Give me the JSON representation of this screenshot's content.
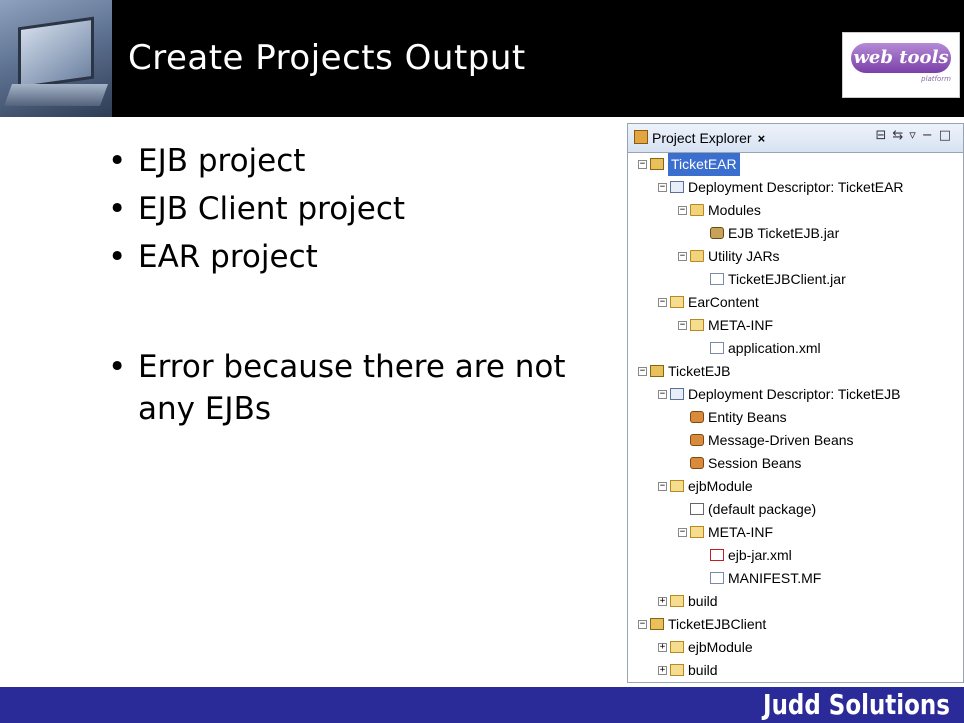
{
  "slide": {
    "title": "Create Projects Output",
    "logo_text": "web tools",
    "logo_subtext": "platform",
    "bullets": [
      {
        "text": "EJB project"
      },
      {
        "text": "EJB Client project"
      },
      {
        "text": "EAR project"
      },
      {
        "text": "Error because there are not any EJBs"
      }
    ],
    "footer_brand": "Judd Solutions"
  },
  "explorer": {
    "tab_label": "Project Explorer",
    "tree": [
      {
        "label": "TicketEAR",
        "icon": "ear-project-icon",
        "selected": true,
        "toggle": "−"
      },
      {
        "label": "Deployment Descriptor: TicketEAR",
        "icon": "deployment-descriptor-icon",
        "toggle": "−"
      },
      {
        "label": "Modules",
        "icon": "folder-icon",
        "toggle": "−"
      },
      {
        "label": "EJB TicketEJB.jar",
        "icon": "ejb-jar-icon"
      },
      {
        "label": "Utility JARs",
        "icon": "folder-icon",
        "toggle": "−"
      },
      {
        "label": "TicketEJBClient.jar",
        "icon": "file-icon"
      },
      {
        "label": "EarContent",
        "icon": "open-folder-icon",
        "toggle": "−"
      },
      {
        "label": "META-INF",
        "icon": "open-folder-icon",
        "toggle": "−"
      },
      {
        "label": "application.xml",
        "icon": "xml-file-icon"
      },
      {
        "label": "TicketEJB",
        "icon": "ejb-project-error-icon",
        "toggle": "−"
      },
      {
        "label": "Deployment Descriptor: TicketEJB",
        "icon": "deployment-descriptor-icon",
        "toggle": "−"
      },
      {
        "label": "Entity Beans",
        "icon": "entity-bean-icon"
      },
      {
        "label": "Message-Driven Beans",
        "icon": "message-bean-icon"
      },
      {
        "label": "Session Beans",
        "icon": "session-bean-icon"
      },
      {
        "label": "ejbModule",
        "icon": "source-folder-icon",
        "toggle": "−"
      },
      {
        "label": "(default package)",
        "icon": "package-icon"
      },
      {
        "label": "META-INF",
        "icon": "open-folder-error-icon",
        "toggle": "−"
      },
      {
        "label": "ejb-jar.xml",
        "icon": "xml-error-icon"
      },
      {
        "label": "MANIFEST.MF",
        "icon": "file-icon"
      },
      {
        "label": "build",
        "icon": "open-folder-icon",
        "toggle": "+"
      },
      {
        "label": "TicketEJBClient",
        "icon": "java-project-icon",
        "toggle": "−"
      },
      {
        "label": "ejbModule",
        "icon": "source-folder-icon",
        "toggle": "+"
      },
      {
        "label": "build",
        "icon": "open-folder-icon",
        "toggle": "+"
      }
    ]
  }
}
